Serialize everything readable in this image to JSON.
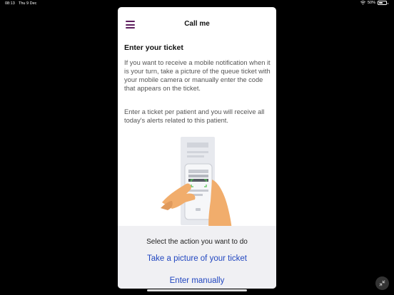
{
  "status_bar": {
    "time": "08:13",
    "date": "Thu 9 Dec",
    "battery": "50%",
    "battery_level": 0.5,
    "icons": [
      "wifi-icon",
      "battery-icon"
    ]
  },
  "nav": {
    "title": "Call me",
    "menu_icon": "hamburger-menu-icon"
  },
  "content": {
    "heading": "Enter your ticket",
    "paragraph_1": "If you want to receive a mobile notification when it is your turn, take a picture of the queue ticket with your mobile camera or manually enter the code that appears on the ticket.",
    "paragraph_2": "Enter a ticket per patient and you will receive all today's alerts related to this patient.",
    "illustration": "hand-holding-phone-scanning-ticket"
  },
  "action_sheet": {
    "title": "Select the action you want to do",
    "take_picture_label": "Take a picture of your ticket",
    "enter_manually_label": "Enter manually"
  },
  "colors": {
    "accent": "#5e1f5f",
    "link": "#2247c0",
    "sheet_background": "#f0f0f3",
    "body_text": "#555555"
  }
}
